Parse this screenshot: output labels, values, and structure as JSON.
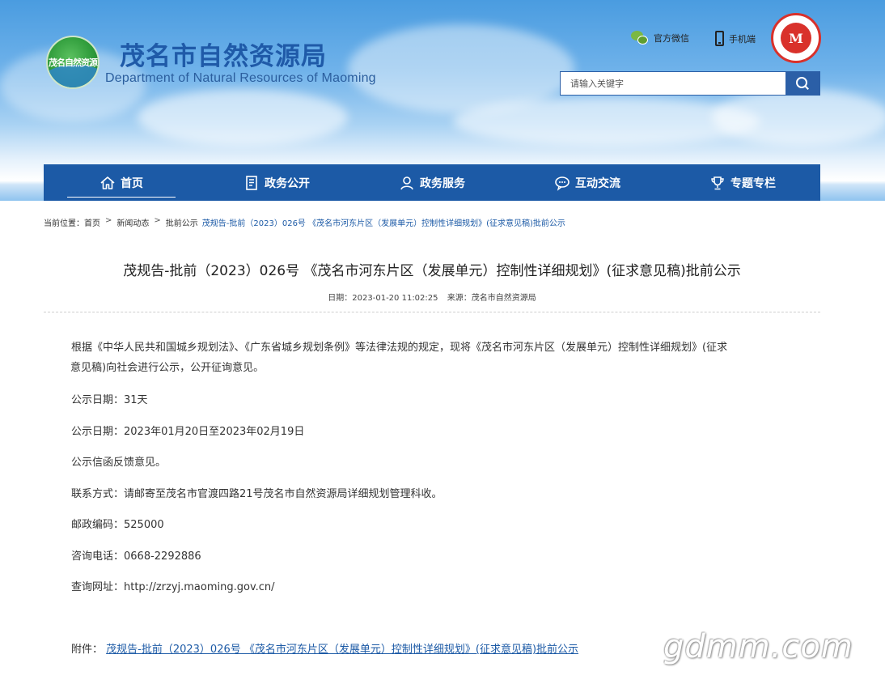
{
  "header": {
    "logo_text": "茂名自然资源",
    "title": "茂名市自然资源局",
    "subtitle": "Department of Natural Resources of Maoming",
    "wechat_label": "官方微信",
    "mobile_label": "手机端",
    "emblem_text": "M",
    "search": {
      "placeholder": "请输入关键字"
    }
  },
  "nav": {
    "items": [
      {
        "label": "首页",
        "icon": "home-icon"
      },
      {
        "label": "政务公开",
        "icon": "document-icon"
      },
      {
        "label": "政务服务",
        "icon": "user-service-icon"
      },
      {
        "label": "互动交流",
        "icon": "chat-icon"
      },
      {
        "label": "专题专栏",
        "icon": "trophy-icon"
      }
    ],
    "active_index": 0
  },
  "breadcrumb": {
    "prefix": "当前位置：",
    "items": [
      "首页",
      "新闻动态",
      "批前公示"
    ],
    "separator": ">",
    "current": "茂规告-批前（2023）026号 《茂名市河东片区（发展单元）控制性详细规划》(征求意见稿)批前公示"
  },
  "article": {
    "title": "茂规告-批前（2023）026号 《茂名市河东片区（发展单元）控制性详细规划》(征求意见稿)批前公示",
    "date": "日期：2023-01-20 11:02:25",
    "source": "来源：茂名市自然资源局",
    "intro_line1": "根据《中华人民共和国城乡规划法》、《广东省城乡规划条例》等法律法规的规定，现将《茂名市河东片区（发展单元）控制性详细规划》(征求",
    "intro_line2": "意见稿)向社会进行公示，公开征询意见。",
    "lines": [
      "公示日期：31天",
      "公示日期：2023年01月20日至2023年02月19日",
      "公示信函反馈意见。",
      "联系方式：请邮寄至茂名市官渡四路21号茂名市自然资源局详细规划管理科收。",
      "邮政编码：525000",
      "咨询电话：0668-2292886",
      "查询网址：http://zrzyj.maoming.gov.cn/"
    ],
    "attachment_label": "附件：",
    "attachment_link": "茂规告-批前（2023）026号 《茂名市河东片区（发展单元）控制性详细规划》(征求意见稿)批前公示"
  },
  "watermark": "gdmm.com"
}
